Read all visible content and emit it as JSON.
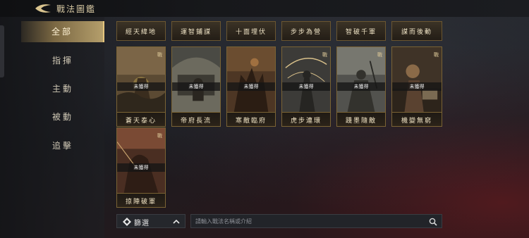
{
  "header": {
    "title": "戰法圖鑑"
  },
  "sidebar": {
    "items": [
      {
        "label": "全部",
        "active": true
      },
      {
        "label": "指揮"
      },
      {
        "label": "主動"
      },
      {
        "label": "被動"
      },
      {
        "label": "追擊"
      }
    ]
  },
  "tactics_top": [
    "經天緯地",
    "運智鋪謀",
    "十面埋伏",
    "步步為營",
    "智破千軍",
    "謀而後動"
  ],
  "status_text": "未獲得",
  "corner_mark": "戰",
  "tactics": [
    "蒼天泰心",
    "帝府長流",
    "寒敵臨府",
    "虎步連環",
    "踐墨隨敵",
    "機變無窮",
    "掠陣破軍"
  ],
  "bottom": {
    "filter_label": "篩選",
    "search_placeholder": "請輸入戰法名稱或介紹"
  },
  "colors": {
    "accent_gold": "#e6c67e",
    "card_border": "#7a6334",
    "bg_red_glow": "#78191e"
  },
  "icons": [
    "back-arrow-icon",
    "filter-icon",
    "chevron-up-icon",
    "search-icon"
  ]
}
